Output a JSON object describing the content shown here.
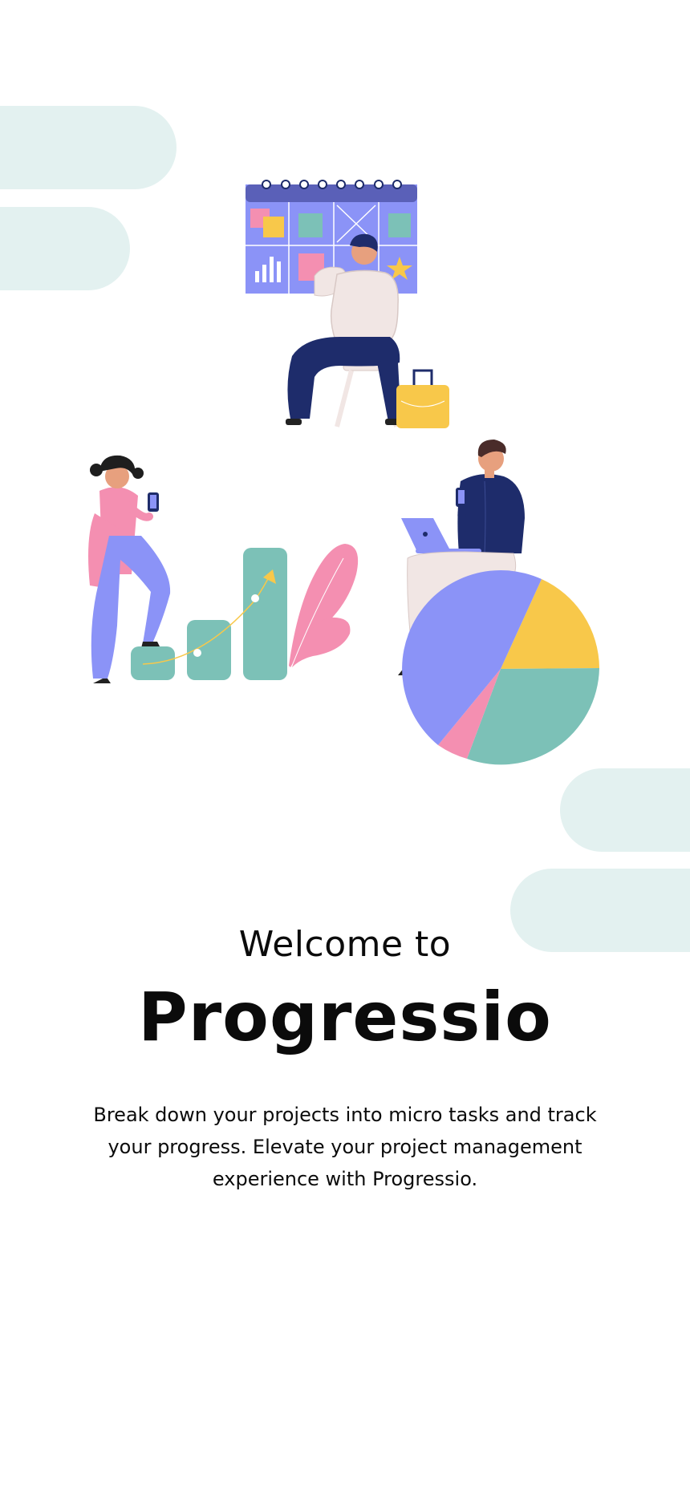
{
  "colors": {
    "background": "#ffffff",
    "pill": "#e3f1f0",
    "navy": "#1e2c6b",
    "periwinkle": "#8b93f7",
    "teal": "#7cc1b7",
    "pink": "#f48fb1",
    "yellow": "#f8c84a",
    "text": "#0b0b0b"
  },
  "illustration": {
    "icons": [
      "calendar-board-icon",
      "person-at-board-icon",
      "bag-icon",
      "woman-climbing-icon",
      "bar-chart-icon",
      "plant-icon",
      "man-with-laptop-icon",
      "pie-chart-icon"
    ]
  },
  "onboarding": {
    "welcome": "Welcome to",
    "app_name": "Progressio",
    "description": "Break down your projects into micro tasks and track your progress. Elevate your project management experience with Progressio."
  }
}
